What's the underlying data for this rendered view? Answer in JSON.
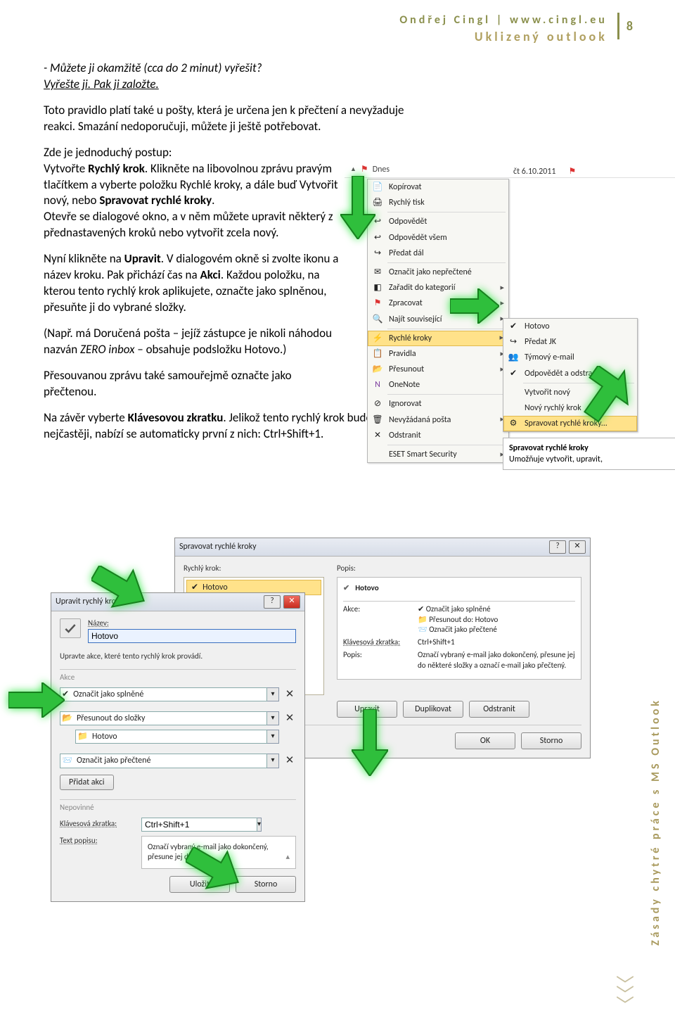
{
  "header": {
    "author_line": "Ondřej Cingl | www.cingl.eu",
    "subtitle": "Uklizený outlook",
    "page": "8"
  },
  "article": {
    "q_line": "- Můžete ji okamžitě (cca do 2 minut) vyřešit?",
    "q_sub": "Vyřešte ji. Pak ji založte.",
    "p1_a": "Toto pravidlo platí také u pošty, která je určena jen k přečtení a nevyžaduje reakci. Smazání nedoporučuji, můžete ji ještě potřebovat.",
    "p2_a": "Zde je jednoduchý postup:",
    "p2_b1": "Vytvořte ",
    "p2_b2": "Rychlý krok",
    "p2_b3": ". Klikněte na libovolnou zprávu pravým tlačítkem a vyberte položku Rychlé kroky, a dále buď Vytvořit nový, nebo ",
    "p2_b4": "Spravovat rychlé kroky",
    "p2_b5": ".",
    "p2_c": "Otevře se dialogové okno, a v něm můžete upravit některý z přednastavených kroků nebo vytvořit zcela nový.",
    "p3_a": "Nyní klikněte na ",
    "p3_b": "Upravit",
    "p3_c": ". V dialogovém okně si zvolte ikonu a název kroku. Pak přichází čas na ",
    "p3_d": "Akci",
    "p3_e": ". Každou položku, na kterou tento rychlý krok aplikujete, označte jako splněnou, přesuňte ji do vybrané složky.",
    "p4": "(Např. má Doručená pošta – jejíž zástupce je nikoli náhodou nazván ZERO inbox – obsahuje podsložku Hotovo.)",
    "p5a": "Přesouvanou zprávu také samouřejmě označte jako přečtenou.",
    "p5b_a": "Na závěr vyberte ",
    "p5b_b": "Klávesovou zkratku",
    "p5b_c": ". Jelikož tento rychlý krok budete patrně používat nejčastěji, nabízí se automaticky první z nich: Ctrl+Shift+1."
  },
  "ctx_menu": {
    "today": "Dnes",
    "date": "čt 6.10.2011",
    "items": [
      "Kopírovat",
      "Rychlý tisk",
      "Odpovědět",
      "Odpovědět všem",
      "Předat dál",
      "Označit jako nepřečtené",
      "Zařadit do kategorií",
      "Zpracovat",
      "Najít související",
      "Rychlé kroky",
      "Pravidla",
      "Přesunout",
      "OneNote",
      "Ignorovat",
      "Nevyžádaná pošta",
      "Odstranit",
      "ESET Smart Security"
    ],
    "sub_items": [
      "Hotovo",
      "Předat JK",
      "Týmový e-mail",
      "Odpovědět a odstra...",
      "Vytvořit nový",
      "Nový rychlý krok",
      "Spravovat rychlé kroky..."
    ],
    "sub_note_title": "Spravovat rychlé kroky",
    "sub_note_txt": "Umožňuje vytvořit, upravit,"
  },
  "win_manage": {
    "title": "Spravovat rychlé kroky",
    "lbl_step": "Rychlý krok:",
    "sel_step": "Hotovo",
    "lbl_popis": "Popis:",
    "name": "Hotovo",
    "lbl_akce": "Akce:",
    "actions": [
      "Označit jako splněné",
      "Přesunout do: Hotovo",
      "Označit jako přečtené"
    ],
    "lbl_short": "Klávesová zkratka:",
    "short_val": "Ctrl+Shift+1",
    "lbl_popis2": "Popis:",
    "popis_val": "Označí vybraný e-mail jako dokončený, přesune jej do některé složky a označí e-mail jako přečtený.",
    "btn_upravit": "Upravit",
    "btn_dup": "Duplikovat",
    "btn_del": "Odstranit",
    "btn_ok": "OK",
    "btn_storno": "Storno"
  },
  "win_edit": {
    "title": "Upravit rychlý krok",
    "lbl_name": "Název:",
    "name_value": "Hotovo",
    "instr": "Upravte akce, které tento rychlý krok provádí.",
    "lbl_akce": "Akce",
    "a1": "Označit jako splněné",
    "a2": "Přesunout do složky",
    "a2_sub": "Hotovo",
    "a3": "Označit jako přečtené",
    "btn_add": "Přidat akci",
    "lbl_nep": "Nepovinné",
    "lbl_short": "Klávesová zkratka:",
    "short_val": "Ctrl+Shift+1",
    "lbl_text": "Text popisu:",
    "text_val": "Označí vybraný e-mail jako dokončený, přesune jej do",
    "btn_save": "Uložit",
    "btn_storno": "Storno"
  },
  "side_text": "Zásady chytré práce s MS Outlook"
}
